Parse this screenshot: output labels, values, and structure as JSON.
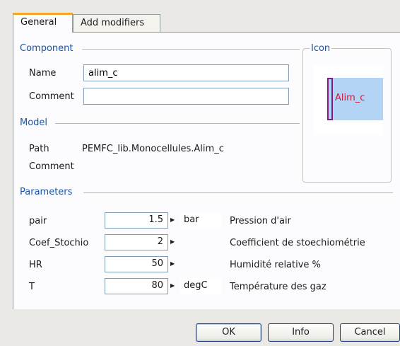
{
  "tabs": [
    {
      "label": "General"
    },
    {
      "label": "Add modifiers"
    }
  ],
  "component": {
    "section_title": "Component",
    "name_label": "Name",
    "name_value": "alim_c",
    "comment_label": "Comment",
    "comment_value": ""
  },
  "icon_panel": {
    "section_title": "Icon",
    "icon_text": "Alim_c"
  },
  "model": {
    "section_title": "Model",
    "path_label": "Path",
    "path_value": "PEMFC_lib.Monocellules.Alim_c",
    "comment_label": "Comment"
  },
  "parameters": {
    "section_title": "Parameters",
    "rows": [
      {
        "name": "pair",
        "value": "1.5",
        "unit": "bar",
        "description": "Pression d'air"
      },
      {
        "name": "Coef_Stochio",
        "value": "2",
        "unit": "",
        "description": "Coefficient de stoechiométrie"
      },
      {
        "name": "HR",
        "value": "50",
        "unit": "",
        "description": "Humidité relative %"
      },
      {
        "name": "T",
        "value": "80",
        "unit": "degC",
        "description": "Température des gaz"
      }
    ]
  },
  "buttons": {
    "ok": "OK",
    "info": "Info",
    "cancel": "Cancel"
  },
  "colors": {
    "section_title": "#1a54a8",
    "active_tab_accent": "#f5a623",
    "icon_fill": "#b4d4f6",
    "icon_text": "#d11a3a"
  }
}
